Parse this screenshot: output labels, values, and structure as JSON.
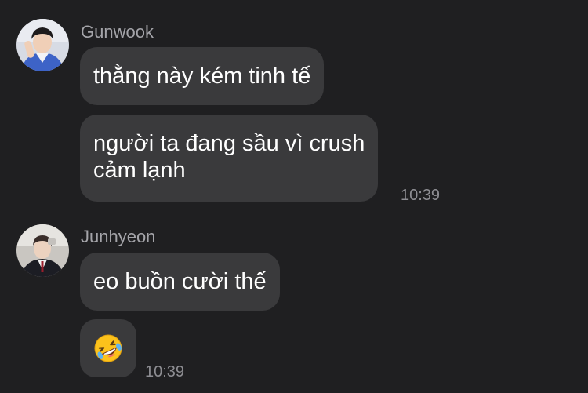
{
  "messages": [
    {
      "sender": "Gunwook",
      "avatar_icon": "user-avatar-gunwook",
      "bubbles": [
        {
          "lines": [
            "thằng này kém tinh tế"
          ]
        },
        {
          "lines": [
            "người ta đang sầu vì crush",
            "cảm lạnh"
          ],
          "time": "10:39"
        }
      ]
    },
    {
      "sender": "Junhyeon",
      "avatar_icon": "user-avatar-junhyeon",
      "bubbles": [
        {
          "lines": [
            "eo buồn cười thế"
          ]
        },
        {
          "emoji": "rolling-on-the-floor-laughing-emoji",
          "time": "10:39"
        }
      ]
    }
  ],
  "colors": {
    "background": "#1f1f21",
    "bubble": "#3a3a3c",
    "sender_text": "#a4a4a9",
    "time_text": "#8e8e93",
    "message_text": "#ffffff"
  }
}
